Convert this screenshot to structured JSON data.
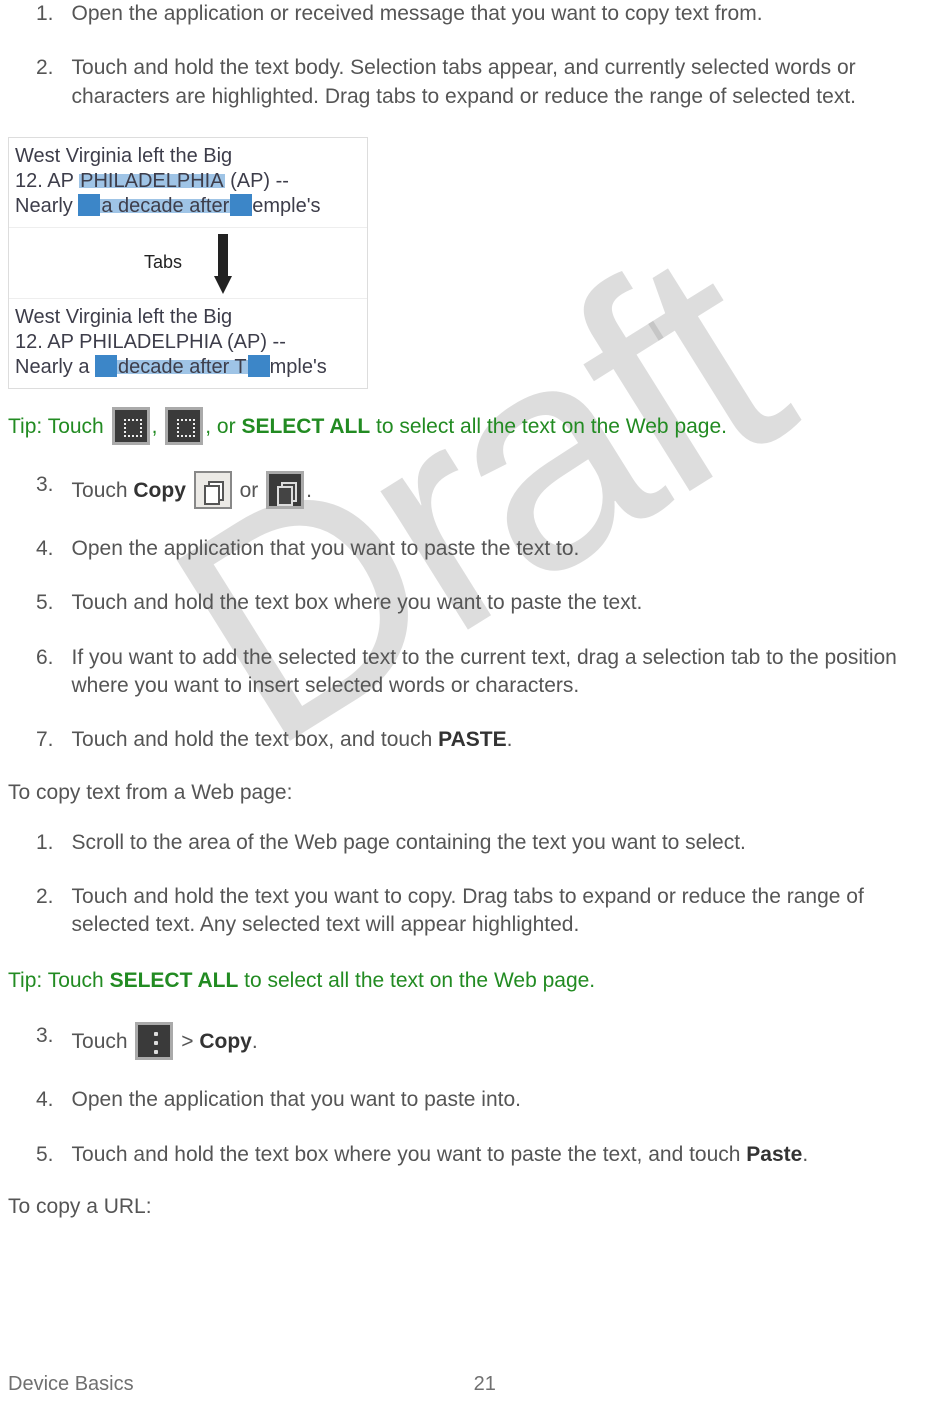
{
  "watermark": "Draft",
  "steps_a": [
    {
      "n": "1.",
      "t": "Open the application or received message that you want to copy text from."
    },
    {
      "n": "2.",
      "t": "Touch and hold the text body. Selection tabs appear, and currently selected words or characters are highlighted. Drag tabs to expand or reduce the range of selected text."
    }
  ],
  "fig": {
    "sample_line1": "West Virginia left the Big",
    "sample_line2_a": "12. AP ",
    "sample_hl1": "PHILADELPHIA",
    "sample_line2_b": " (AP) --",
    "sample_line3_a": "Nearly ",
    "sample_hl2a": "a decade after",
    "sample_line3_b": "emple's",
    "tabs_label": "Tabs",
    "sample2_line1": "West Virginia left the Big",
    "sample2_line2": "12. AP PHILADELPHIA (AP) --",
    "sample2_line3_a": "Nearly a ",
    "sample2_hl": "decade after T",
    "sample2_line3_b": "mple's"
  },
  "tip1": {
    "label": "Tip",
    "prefix": ": Touch ",
    "mid": ", ",
    "or": ", or ",
    "select_all": "SELECT ALL",
    "suffix": " to select all the text on the Web page."
  },
  "steps_b": [
    {
      "n": "3.",
      "pre": "Touch ",
      "bold": "Copy",
      "post1": " ",
      "post2": " or ",
      "post3": "."
    },
    {
      "n": "4.",
      "t": " Open the application that you want to paste the text to."
    },
    {
      "n": "5.",
      "t": " Touch and hold the text box where you want to paste the text."
    },
    {
      "n": "6.",
      "t": " If you want to add the selected text to the current text, drag a selection tab to the position where you want to insert selected words or characters."
    }
  ],
  "step7": {
    "n": "7.",
    "pre": " Touch and hold the text box, and touch ",
    "bold": "PASTE",
    "post": "."
  },
  "para_web": "To copy text from a Web page:",
  "steps_c": [
    {
      "n": "1.",
      "t": "Scroll to the area of the Web page containing the text you want to select."
    },
    {
      "n": "2.",
      "t": "Touch and hold the text you want to copy. Drag tabs to expand or reduce the range of selected text. Any selected text will appear highlighted."
    }
  ],
  "tip2": {
    "label": "Tip",
    "prefix": ": Touch ",
    "select_all": "SELECT ALL",
    "suffix": " to select all the text on the Web page."
  },
  "steps_d": [
    {
      "n": "3.",
      "pre": "Touch ",
      "mid": " > ",
      "bold": "Copy",
      "post": "."
    },
    {
      "n": "4.",
      "t": "Open the application that you want to paste into."
    }
  ],
  "step_d5": {
    "n": "5.",
    "pre": "Touch and hold the text box where you want to paste the text, and touch ",
    "bold": "Paste",
    "post": "."
  },
  "para_url": "To copy a URL:",
  "footer": {
    "section": "Device Basics",
    "page": "21"
  }
}
